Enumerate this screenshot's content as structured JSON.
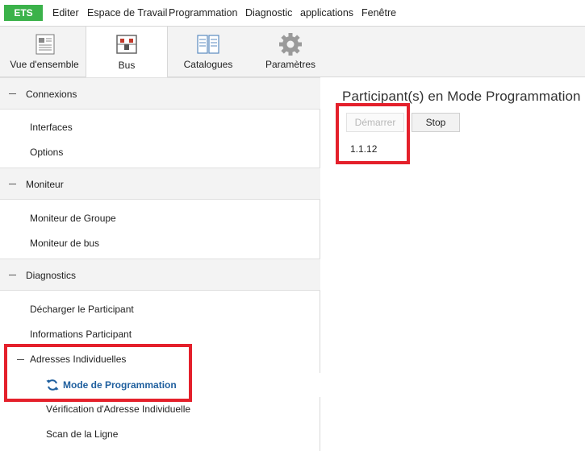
{
  "menubar": {
    "app_button": "ETS",
    "items": [
      "Editer",
      "Espace de Travail",
      "Programmation",
      "Diagnostic",
      "applications",
      "Fenêtre"
    ]
  },
  "ribbon": {
    "tabs": [
      {
        "label": "Vue d'ensemble",
        "icon": "overview-icon"
      },
      {
        "label": "Bus",
        "icon": "bus-icon",
        "active": true
      },
      {
        "label": "Catalogues",
        "icon": "catalog-icon"
      },
      {
        "label": "Paramètres",
        "icon": "gear-icon"
      }
    ]
  },
  "left_panel": {
    "sections": [
      {
        "title": "Connexions",
        "items": [
          "Interfaces",
          "Options"
        ]
      },
      {
        "title": "Moniteur",
        "items": [
          "Moniteur de Groupe",
          "Moniteur de bus"
        ]
      },
      {
        "title": "Diagnostics",
        "items": [
          "Décharger le Participant",
          "Informations Participant"
        ]
      }
    ],
    "subgroup": {
      "title": "Adresses Individuelles",
      "active_item": "Mode de Programmation",
      "items": [
        "Vérification d'Adresse Individuelle",
        "Scan de la Ligne"
      ]
    }
  },
  "right_panel": {
    "title": "Participant(s) en Mode Programmation",
    "start_button": "Démarrer",
    "stop_button": "Stop",
    "devices": [
      "1.1.12"
    ]
  },
  "colors": {
    "accent_green": "#3bb24a",
    "active_link": "#1f5f9e",
    "highlight_red": "#e4202b"
  }
}
